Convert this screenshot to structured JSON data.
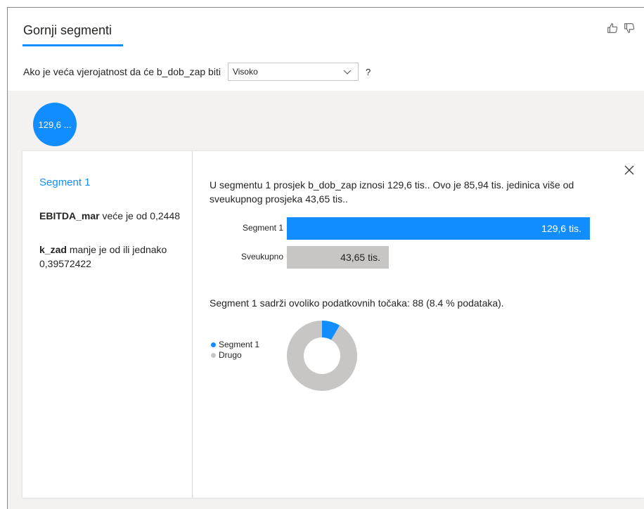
{
  "header": {
    "title": "Gornji segmenti"
  },
  "question": {
    "prefix": "Ako je veća vjerojatnost da će b_dob_zap biti",
    "selected": "Visoko",
    "suffix": "?"
  },
  "bubble": {
    "label": "129,6 ..."
  },
  "segment": {
    "name": "Segment 1",
    "conditions": [
      {
        "field": "EBITDA_mar",
        "rule": "veće je od 0,2448"
      },
      {
        "field": "k_zad",
        "rule": "manje je od ili jednako 0,39572422"
      }
    ],
    "summary": "U segmentu 1 prosjek b_dob_zap iznosi 129,6 tis.. Ovo je 85,94 tis. jedinica više od sveukupnog prosjeka 43,65 tis..",
    "points_text": "Segment 1 sadrži ovoliko podatkovnih točaka: 88 (8.4 % podataka)."
  },
  "chart_data": [
    {
      "type": "bar",
      "categories": [
        "Segment 1",
        "Sveukupno"
      ],
      "values": [
        129.6,
        43.65
      ],
      "data_labels": [
        "129,6 tis.",
        "43,65 tis."
      ],
      "colors": [
        "#118dff",
        "#c8c6c4"
      ]
    },
    {
      "type": "pie",
      "labels": [
        "Segment 1",
        "Drugo"
      ],
      "values": [
        8.4,
        91.6
      ],
      "colors": [
        "#118dff",
        "#c8c6c4"
      ]
    }
  ],
  "colors": {
    "accent": "#118dff",
    "gray": "#c8c6c4"
  }
}
